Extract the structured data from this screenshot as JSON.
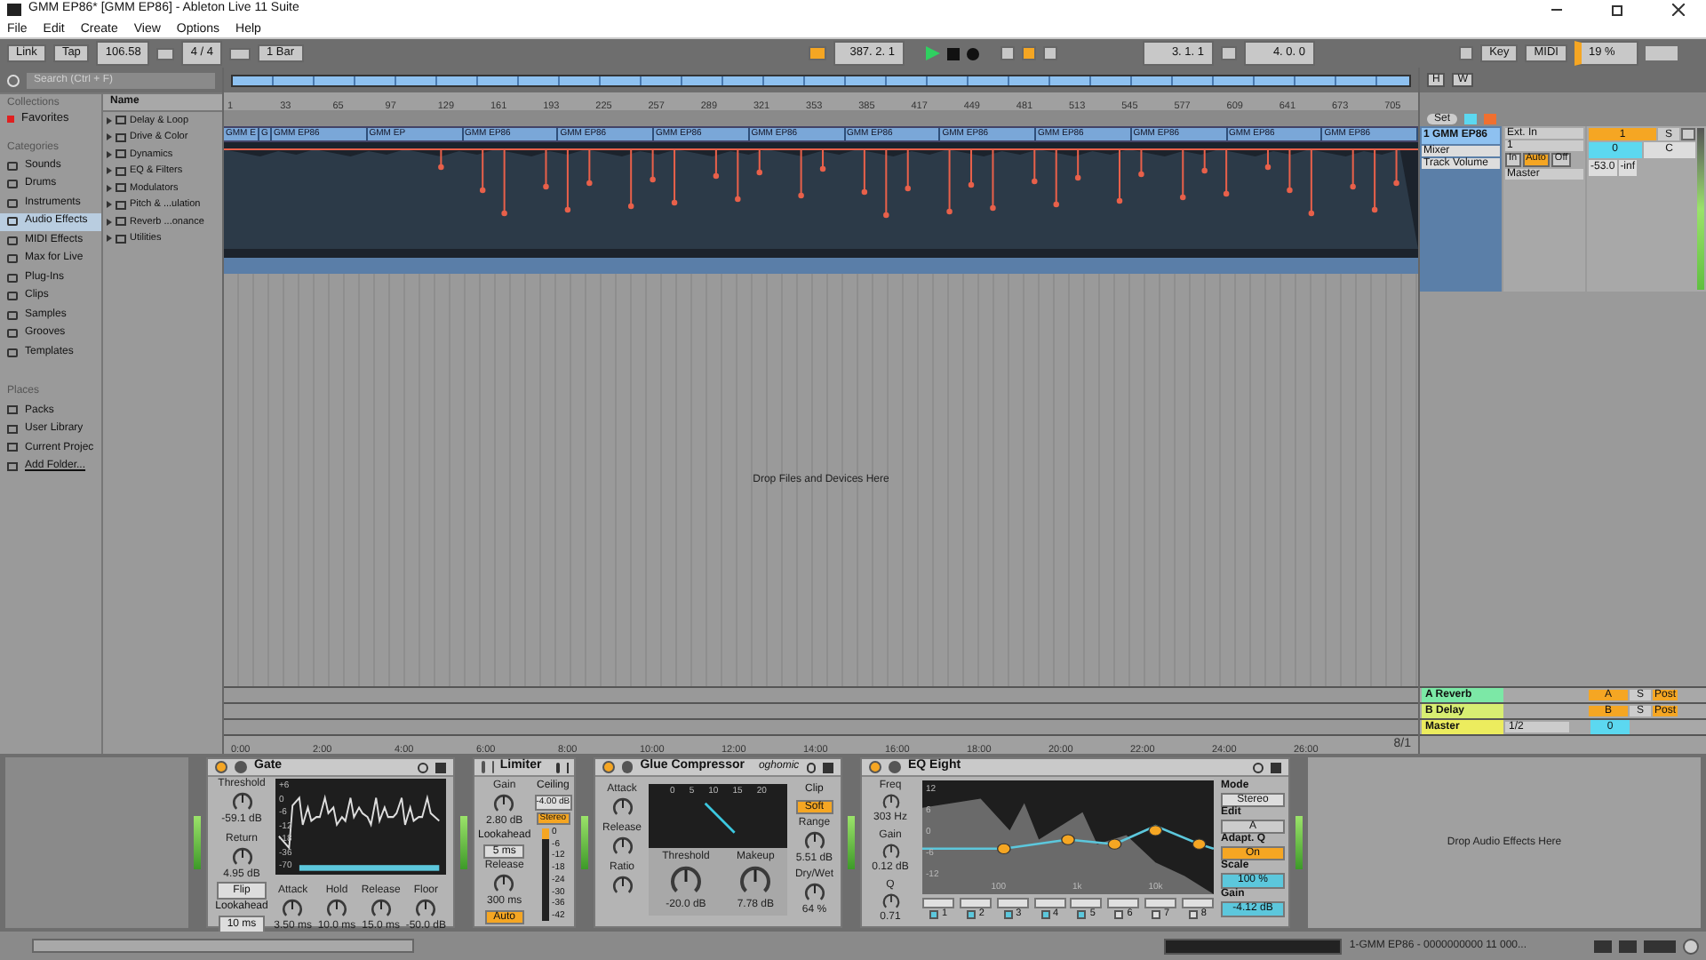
{
  "window": {
    "title": "GMM EP86*  [GMM EP86] - Ableton Live 11 Suite"
  },
  "menu": [
    "File",
    "Edit",
    "Create",
    "View",
    "Options",
    "Help"
  ],
  "control_bar": {
    "link": "Link",
    "tap": "Tap",
    "tempo": "106.58",
    "signature": "4 / 4",
    "quantize": "1 Bar",
    "position": "387.   2.   1",
    "loop_start": "3.   1.   1",
    "loop_length": "4.   0.   0",
    "key": "Key",
    "midi": "MIDI",
    "cpu": "19 %"
  },
  "overview": {
    "buttons": [
      "H",
      "W"
    ]
  },
  "browser": {
    "search": {
      "placeholder": "Search (Ctrl + F)"
    },
    "collections_header": "Collections",
    "collections": [
      {
        "label": "Favorites",
        "color": "#e02020"
      }
    ],
    "categories_header": "Categories",
    "categories": [
      {
        "label": "Sounds",
        "selected": false
      },
      {
        "label": "Drums",
        "selected": false
      },
      {
        "label": "Instruments",
        "selected": false
      },
      {
        "label": "Audio Effects",
        "selected": true
      },
      {
        "label": "MIDI Effects",
        "selected": false
      },
      {
        "label": "Max for Live",
        "selected": false
      },
      {
        "label": "Plug-Ins",
        "selected": false
      },
      {
        "label": "Clips",
        "selected": false
      },
      {
        "label": "Samples",
        "selected": false
      },
      {
        "label": "Grooves",
        "selected": false
      },
      {
        "label": "Templates",
        "selected": false
      }
    ],
    "places_header": "Places",
    "places": [
      "Packs",
      "User Library",
      "Current Projec",
      "Add Folder..."
    ],
    "name_header": "Name",
    "folders": [
      "Delay & Loop",
      "Drive & Color",
      "Dynamics",
      "EQ & Filters",
      "Modulators",
      "Pitch & ...ulation",
      "Reverb ...onance",
      "Utilities"
    ]
  },
  "arrangement": {
    "ruler": [
      "1",
      "33",
      "65",
      "97",
      "129",
      "161",
      "193",
      "225",
      "257",
      "289",
      "321",
      "353",
      "385",
      "417",
      "449",
      "481",
      "513",
      "545",
      "577",
      "609",
      "641",
      "673",
      "705"
    ],
    "clips": [
      "GMM E",
      "G",
      "GMM EP86",
      "GMM EP",
      "GMM EP86",
      "GMM EP86",
      "GMM EP86",
      "GMM EP86",
      "GMM EP86",
      "GMM EP86",
      "GMM EP86",
      "GMM EP86",
      "GMM EP86",
      "GMM EP86"
    ],
    "drop_hint": "Drop Files and Devices Here",
    "time": [
      "0:00",
      "2:00",
      "4:00",
      "6:00",
      "8:00",
      "10:00",
      "12:00",
      "14:00",
      "16:00",
      "18:00",
      "20:00",
      "22:00",
      "24:00",
      "26:00"
    ],
    "zoom": "8/1"
  },
  "set_button": "Set",
  "track": {
    "name": "1 GMM EP86",
    "device_chooser": "Mixer",
    "param_chooser": "Track Volume",
    "input": "Ext. In",
    "input_channel": "1",
    "monitor": [
      {
        "label": "In",
        "selected": false
      },
      {
        "label": "Auto",
        "selected": true
      },
      {
        "label": "Off",
        "selected": false
      }
    ],
    "output": "Master",
    "number": "1",
    "solo": "S",
    "pan": "0",
    "pan_mode": "C",
    "volume": "-53.0",
    "peak": "-inf"
  },
  "returns": [
    {
      "kind": "return",
      "name": "A Reverb",
      "color": "#7ce8a6",
      "send": "A",
      "solo": "S",
      "post": "Post"
    },
    {
      "kind": "return",
      "name": "B Delay",
      "color": "#d8ee72",
      "send": "B",
      "solo": "S",
      "post": "Post"
    },
    {
      "kind": "master",
      "name": "Master",
      "color": "#ecec5e",
      "cue": "1/2",
      "pan": "0"
    }
  ],
  "devices": [
    {
      "kind": "gate",
      "name": "Gate",
      "scale": [
        "+6",
        "0",
        "-6",
        "-12",
        "-18",
        "-36",
        "-70"
      ],
      "params": [
        {
          "label": "Threshold",
          "value": "-59.1 dB"
        },
        {
          "label": "Return",
          "value": "4.95 dB"
        }
      ],
      "flip": "Flip",
      "lookahead_label": "Lookahead",
      "lookahead": "10 ms",
      "bottom": [
        {
          "label": "Attack",
          "value": "3.50 ms"
        },
        {
          "label": "Hold",
          "value": "10.0 ms"
        },
        {
          "label": "Release",
          "value": "15.0 ms"
        },
        {
          "label": "Floor",
          "value": "-50.0 dB"
        }
      ]
    },
    {
      "kind": "limiter",
      "name": "Limiter",
      "gain": {
        "label": "Gain",
        "value": "2.80 dB"
      },
      "ceiling_label": "Ceiling",
      "ceiling": "-4.00 dB",
      "stereo": "Stereo",
      "lookahead_label": "Lookahead",
      "lookahead": "5 ms",
      "release": {
        "label": "Release",
        "value": "300 ms"
      },
      "auto": "Auto",
      "scale": [
        "0",
        "-6",
        "-12",
        "-18",
        "-24",
        "-30",
        "-36",
        "-42"
      ]
    },
    {
      "kind": "glue",
      "name": "Glue Compressor",
      "preset": "oghomic",
      "small": [
        {
          "label": "Attack"
        },
        {
          "label": "Release"
        },
        {
          "label": "Ratio"
        }
      ],
      "meter_scale": [
        "0",
        "5",
        "10",
        "15",
        "20"
      ],
      "big": [
        {
          "label": "Threshold",
          "value": "-20.0 dB"
        },
        {
          "label": "Makeup",
          "value": "7.78 dB"
        }
      ],
      "clip_label": "Clip",
      "clip": "Soft",
      "right": [
        {
          "label": "Range",
          "value": "5.51 dB"
        },
        {
          "label": "Dry/Wet",
          "value": "64 %"
        }
      ]
    },
    {
      "kind": "eq",
      "name": "EQ Eight",
      "params": [
        {
          "label": "Freq",
          "value": "303 Hz"
        },
        {
          "label": "Gain",
          "value": "0.12 dB"
        },
        {
          "label": "Q",
          "value": "0.71"
        }
      ],
      "db_scale": [
        "12",
        "6",
        "0",
        "-6",
        "-12"
      ],
      "freq_scale": [
        "100",
        "1k",
        "10k"
      ],
      "bands": [
        {
          "label": "1",
          "on": true
        },
        {
          "label": "2",
          "on": true
        },
        {
          "label": "3",
          "on": true
        },
        {
          "label": "4",
          "on": true
        },
        {
          "label": "5",
          "on": true
        },
        {
          "label": "6",
          "on": false
        },
        {
          "label": "7",
          "on": false
        },
        {
          "label": "8",
          "on": false
        }
      ],
      "mode_label": "Mode",
      "mode": "Stereo",
      "edit_label": "Edit",
      "edit": "A",
      "adapt_label": "Adapt. Q",
      "adapt": "On",
      "scale_label": "Scale",
      "scale": "100 %",
      "gain_label": "Gain",
      "gain": "-4.12 dB"
    }
  ],
  "drop_effects": "Drop Audio Effects Here",
  "status": {
    "track": "1-GMM EP86 - 0000000000 11 000..."
  }
}
